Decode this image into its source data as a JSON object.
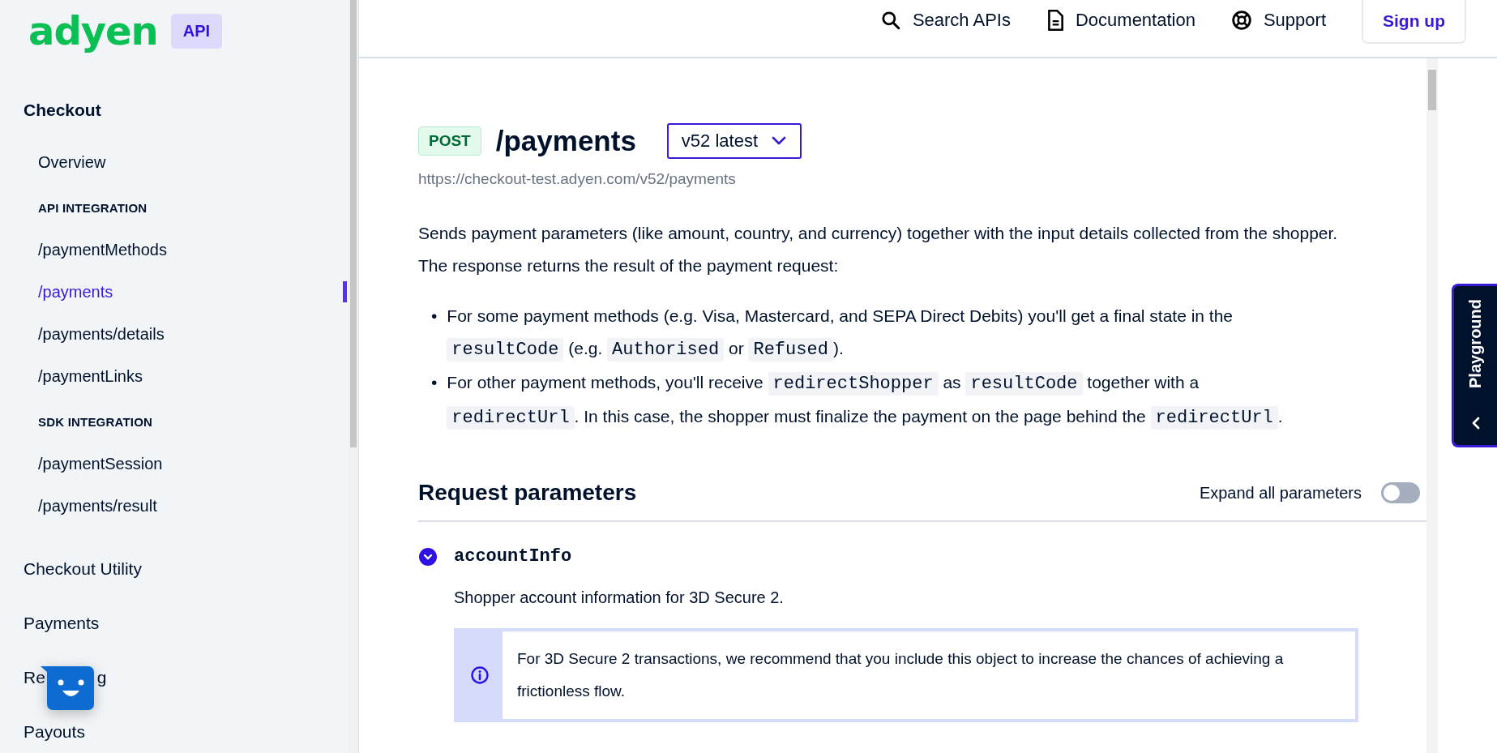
{
  "sidebar": {
    "logo": "adyen",
    "badge": "API",
    "section": {
      "title": "Checkout",
      "items": [
        {
          "kind": "link",
          "label": "Overview",
          "selected": false
        },
        {
          "kind": "heading",
          "label": "API INTEGRATION"
        },
        {
          "kind": "link",
          "label": "/paymentMethods",
          "selected": false
        },
        {
          "kind": "link",
          "label": "/payments",
          "selected": true
        },
        {
          "kind": "link",
          "label": "/payments/details",
          "selected": false
        },
        {
          "kind": "link",
          "label": "/paymentLinks",
          "selected": false
        },
        {
          "kind": "heading",
          "label": "SDK INTEGRATION"
        },
        {
          "kind": "link",
          "label": "/paymentSession",
          "selected": false
        },
        {
          "kind": "link",
          "label": "/payments/result",
          "selected": false
        }
      ]
    },
    "groups": [
      {
        "label": "Checkout Utility"
      },
      {
        "label": "Payments"
      },
      {
        "label": "Re",
        "label_end": "g"
      },
      {
        "label": "Payouts"
      }
    ]
  },
  "header": {
    "nav": [
      {
        "label": "Search APIs"
      },
      {
        "label": "Documentation"
      },
      {
        "label": "Support"
      }
    ],
    "signup": "Sign up"
  },
  "endpoint": {
    "method": "POST",
    "path": "/payments",
    "version": "v52 latest",
    "url": "https://checkout-test.adyen.com/v52/payments"
  },
  "description": "Sends payment parameters (like amount, country, and currency) together with the input details collected from the shopper. The response returns the result of the payment request:",
  "bullet_marker": "•",
  "bullets": [
    [
      {
        "kind": "text",
        "text": "For some payment methods (e.g. Visa, Mastercard, and SEPA Direct Debits) you'll get a final state in the "
      },
      {
        "kind": "code",
        "text": "resultCode"
      },
      {
        "kind": "text",
        "text": " (e.g. "
      },
      {
        "kind": "code",
        "text": "Authorised"
      },
      {
        "kind": "text",
        "text": " or "
      },
      {
        "kind": "code",
        "text": "Refused"
      },
      {
        "kind": "text",
        "text": ")."
      }
    ],
    [
      {
        "kind": "text",
        "text": "For other payment methods, you'll receive "
      },
      {
        "kind": "code",
        "text": "redirectShopper"
      },
      {
        "kind": "text",
        "text": " as "
      },
      {
        "kind": "code",
        "text": "resultCode"
      },
      {
        "kind": "text",
        "text": " together with a "
      },
      {
        "kind": "code",
        "text": "redirectUrl"
      },
      {
        "kind": "text",
        "text": ". In this case, the shopper must finalize the payment on the page behind the "
      },
      {
        "kind": "code",
        "text": "redirectUrl"
      },
      {
        "kind": "text",
        "text": "."
      }
    ]
  ],
  "parameters": {
    "title": "Request parameters",
    "expand_label": "Expand all parameters",
    "expand_all": false,
    "items": [
      {
        "name": "accountInfo",
        "expanded": true,
        "description": "Shopper account information for 3D Secure 2.",
        "note": "For 3D Secure 2 transactions, we recommend that you include this object to increase the chances of achieving a frictionless flow."
      }
    ]
  },
  "playground": {
    "label": "Playground"
  }
}
